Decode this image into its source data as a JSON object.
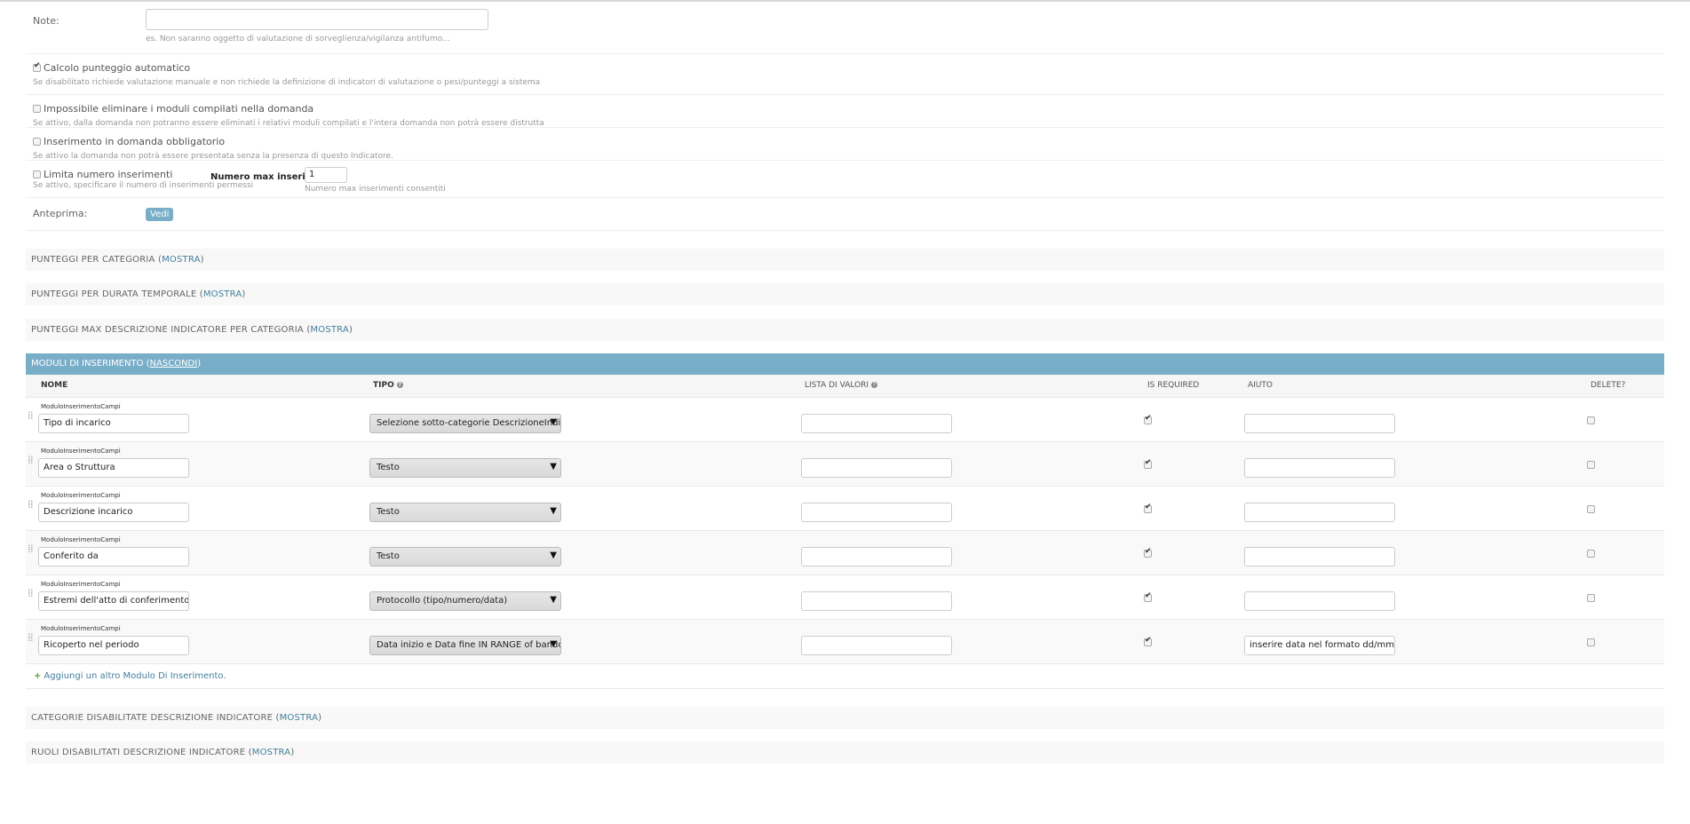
{
  "note": {
    "label": "Note:",
    "value": "",
    "help": "es. Non saranno oggetto di valutazione di sorveglienza/vigilanza antifumo..."
  },
  "options": [
    {
      "label": "Calcolo punteggio automatico",
      "checked": true,
      "help": "Se disabilitato richiede valutazione manuale e non richiede la definizione di indicatori di valutazione o pesi/punteggi a sistema"
    },
    {
      "label": "Impossibile eliminare i moduli compilati nella domanda",
      "checked": false,
      "help": "Se attivo, dalla domanda non potranno essere eliminati i relativi moduli compilati e l'intera domanda non potrà essere distrutta"
    },
    {
      "label": "Inserimento in domanda obbligatorio",
      "checked": false,
      "help": "Se attivo la domanda non potrà essere presentata senza la presenza di questo Indicatore."
    }
  ],
  "limit": {
    "label": "Limita numero inserimenti",
    "checked": false,
    "help": "Se attivo, specificare il numero di inserimenti permessi",
    "max_label": "Numero max inserimenti:",
    "max_value": "1",
    "max_help": "Numero max inserimenti consentiti"
  },
  "preview": {
    "label": "Anteprima:",
    "button": "Vedi"
  },
  "sections_top": [
    {
      "title": "PUNTEGGI PER CATEGORIA",
      "toggle": "MOSTRA"
    },
    {
      "title": "PUNTEGGI PER DURATA TEMPORALE",
      "toggle": "MOSTRA"
    },
    {
      "title": "PUNTEGGI MAX DESCRIZIONE INDICATORE PER CATEGORIA",
      "toggle": "MOSTRA"
    }
  ],
  "moduli": {
    "title": "MODULI DI INSERIMENTO",
    "toggle": "NASCONDI",
    "headers": {
      "nome": "NOME",
      "tipo": "TIPO",
      "lista": "LISTA DI VALORI",
      "required": "IS REQUIRED",
      "aiuto": "AIUTO",
      "delete": "DELETE?"
    },
    "rows": [
      {
        "origin": "ModuloInserimentoCampi",
        "nome": "Tipo di incarico",
        "tipo": "Selezione sotto-categorie DescrizioneIndicatore",
        "lista": "",
        "required": true,
        "aiuto": "",
        "delete": false
      },
      {
        "origin": "ModuloInserimentoCampi",
        "nome": "Area o Struttura",
        "tipo": "Testo",
        "lista": "",
        "required": true,
        "aiuto": "",
        "delete": false
      },
      {
        "origin": "ModuloInserimentoCampi",
        "nome": "Descrizione incarico",
        "tipo": "Testo",
        "lista": "",
        "required": true,
        "aiuto": "",
        "delete": false
      },
      {
        "origin": "ModuloInserimentoCampi",
        "nome": "Conferito da",
        "tipo": "Testo",
        "lista": "",
        "required": true,
        "aiuto": "",
        "delete": false
      },
      {
        "origin": "ModuloInserimentoCampi",
        "nome": "Estremi dell'atto di conferimento (protocollo",
        "tipo": "Protocollo (tipo/numero/data)",
        "lista": "",
        "required": true,
        "aiuto": "",
        "delete": false
      },
      {
        "origin": "ModuloInserimentoCampi",
        "nome": "Ricoperto nel periodo",
        "tipo": "Data inizio e Data fine IN RANGE of bando + 'In corso'",
        "lista": "",
        "required": true,
        "aiuto": "inserire data nel formato dd/mm/yyyy oppure",
        "delete": false
      }
    ],
    "add_label": "Aggiungi un altro Modulo Di Inserimento."
  },
  "sections_bottom": [
    {
      "title": "CATEGORIE DISABILITATE DESCRIZIONE INDICATORE",
      "toggle": "MOSTRA"
    },
    {
      "title": "RUOLI DISABILITATI DESCRIZIONE INDICATORE",
      "toggle": "MOSTRA"
    }
  ],
  "colors": {
    "accent": "#79aec8",
    "link": "#447e9b"
  }
}
